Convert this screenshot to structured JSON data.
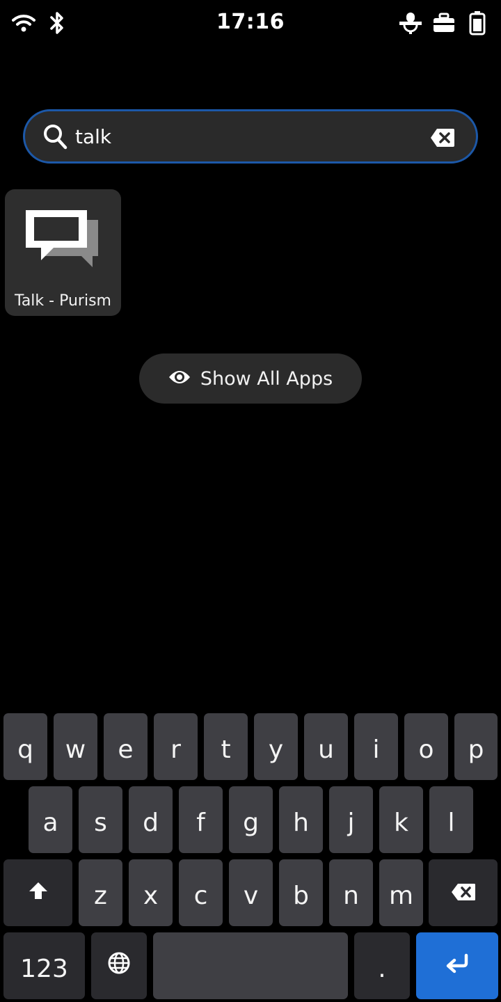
{
  "status_bar": {
    "time": "17:16",
    "icons": [
      "wifi-icon",
      "bluetooth-icon",
      "microphone-muted-icon",
      "work-case-icon",
      "battery-icon"
    ]
  },
  "search": {
    "value": "talk",
    "placeholder": ""
  },
  "results": [
    {
      "label": "Talk - Purism",
      "icon": "chat-bubbles-icon"
    }
  ],
  "show_all": {
    "label": "Show All Apps",
    "icon": "eye-icon"
  },
  "keyboard": {
    "row1": [
      "q",
      "w",
      "e",
      "r",
      "t",
      "y",
      "u",
      "i",
      "o",
      "p"
    ],
    "row2": [
      "a",
      "s",
      "d",
      "f",
      "g",
      "h",
      "j",
      "k",
      "l"
    ],
    "row3": [
      "z",
      "x",
      "c",
      "v",
      "b",
      "n",
      "m"
    ],
    "numbers_label": "123",
    "period_label": ".",
    "shift_icon": "shift-arrow-icon",
    "backspace_icon": "backspace-icon",
    "globe_icon": "globe-icon",
    "enter_icon": "enter-icon"
  },
  "colors": {
    "accent": "#1f6fd6",
    "search_border": "#1c58a8",
    "key": "#3f3f44",
    "key_dark": "#2a2a2e"
  }
}
